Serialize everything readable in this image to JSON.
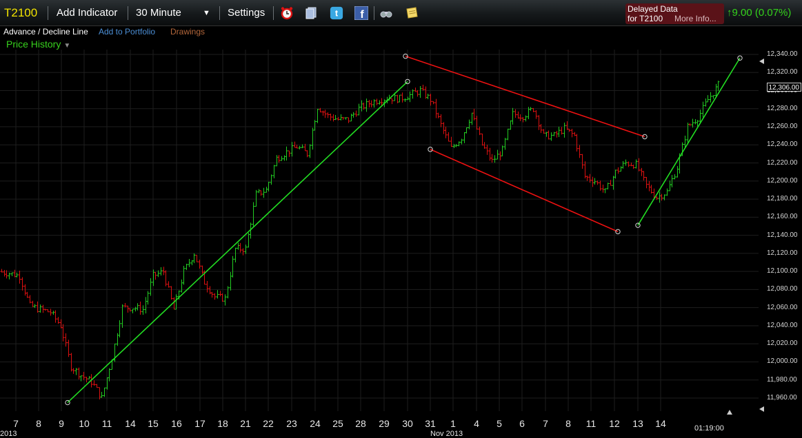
{
  "toolbar": {
    "symbol": "T2100",
    "add_indicator": "Add Indicator",
    "interval": "30 Minute",
    "settings": "Settings",
    "icons": [
      "alarm-clock-icon",
      "layers-icon",
      "twitter-icon",
      "facebook-icon",
      "binoculars-icon",
      "note-icon"
    ]
  },
  "delayed": {
    "line1": "Delayed Data",
    "line2": "for T2100",
    "more": "More Info..."
  },
  "change": {
    "text": "9.00 (0.07%)",
    "direction": "up"
  },
  "subbar": {
    "title": "Advance / Decline Line",
    "portfolio": "Add to Portfolio",
    "drawings": "Drawings"
  },
  "price_history": "Price History",
  "current_price": "12,306.00",
  "time_label": "01:19:00",
  "x_partial": [
    "2013",
    "Nov 2013"
  ],
  "colors": {
    "up": "#22cc22",
    "down": "#dd1111",
    "trend_green": "#22dd22",
    "trend_red": "#ee1111",
    "symbol": "#f2e300",
    "grid": "#1e1e1e"
  },
  "chart_data": {
    "type": "candlestick-ohlc",
    "ylabel": "",
    "ylim": [
      11950,
      12345
    ],
    "y_ticks": [
      "12,340.00",
      "12,320.00",
      "12,300.00",
      "12,280.00",
      "12,260.00",
      "12,240.00",
      "12,220.00",
      "12,200.00",
      "12,180.00",
      "12,160.00",
      "12,140.00",
      "12,120.00",
      "12,100.00",
      "12,080.00",
      "12,060.00",
      "12,040.00",
      "12,020.00",
      "12,000.00",
      "11,980.00",
      "11,960.00"
    ],
    "y_tick_values": [
      12340,
      12320,
      12300,
      12280,
      12260,
      12240,
      12220,
      12200,
      12180,
      12160,
      12140,
      12120,
      12100,
      12080,
      12060,
      12040,
      12020,
      12000,
      11980,
      11960
    ],
    "x_ticks": [
      "7",
      "8",
      "9",
      "10",
      "11",
      "14",
      "15",
      "16",
      "17",
      "18",
      "21",
      "22",
      "23",
      "24",
      "25",
      "28",
      "29",
      "30",
      "31",
      "1",
      "4",
      "5",
      "6",
      "7",
      "8",
      "11",
      "12",
      "13",
      "14"
    ],
    "closes": [
      12100,
      12098,
      12095,
      12062,
      12058,
      12055,
      12040,
      11995,
      11985,
      11978,
      11960,
      12005,
      12060,
      12060,
      12058,
      12095,
      12100,
      12058,
      12100,
      12120,
      12088,
      12072,
      12070,
      12125,
      12125,
      12185,
      12190,
      12225,
      12232,
      12238,
      12230,
      12282,
      12272,
      12268,
      12268,
      12280,
      12286,
      12290,
      12292,
      12291,
      12295,
      12300,
      12290,
      12262,
      12236,
      12248,
      12275,
      12240,
      12222,
      12234,
      12274,
      12272,
      12280,
      12250,
      12250,
      12258,
      12250,
      12205,
      12200,
      12188,
      12210,
      12220,
      12218,
      12195,
      12182,
      12188,
      12215,
      12260,
      12270,
      12290,
      12306
    ],
    "trend_lines": [
      {
        "color": "green",
        "from": [
          "9",
          11955
        ],
        "to": [
          "30",
          12310
        ]
      },
      {
        "color": "red",
        "from": [
          "30",
          12338
        ],
        "to": [
          "13",
          12249
        ]
      },
      {
        "color": "red",
        "from": [
          "31",
          12235
        ],
        "to": [
          "12",
          12144
        ]
      },
      {
        "color": "green",
        "from": [
          "13",
          12151
        ],
        "to": [
          "right-edge",
          12336
        ]
      }
    ]
  }
}
